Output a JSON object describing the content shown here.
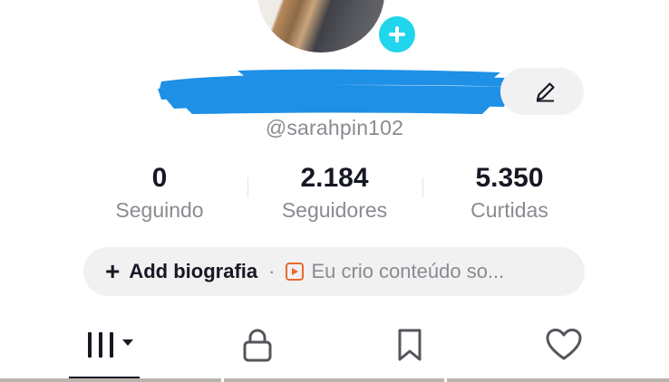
{
  "profile": {
    "username": "@sarahpin102"
  },
  "stats": [
    {
      "value": "0",
      "label": "Seguindo"
    },
    {
      "value": "2.184",
      "label": "Seguidores"
    },
    {
      "value": "5.350",
      "label": "Curtidas"
    }
  ],
  "bio": {
    "plus": "+",
    "add_label": "Add biografia",
    "separator": "·",
    "promo_text": "Eu crio conteúdo so..."
  },
  "tabs": [
    {
      "name": "videos",
      "icon": "grid-icon",
      "active": true
    },
    {
      "name": "private",
      "icon": "lock-icon",
      "active": false
    },
    {
      "name": "saved",
      "icon": "bookmark-icon",
      "active": false
    },
    {
      "name": "liked",
      "icon": "heart-icon",
      "active": false
    }
  ],
  "colors": {
    "accent_plus": "#20d5ec",
    "redaction": "#1e90e6",
    "promo_icon": "#e86a2c",
    "secondary_text": "#8a8b91",
    "pill_bg": "#f1f1f2"
  }
}
